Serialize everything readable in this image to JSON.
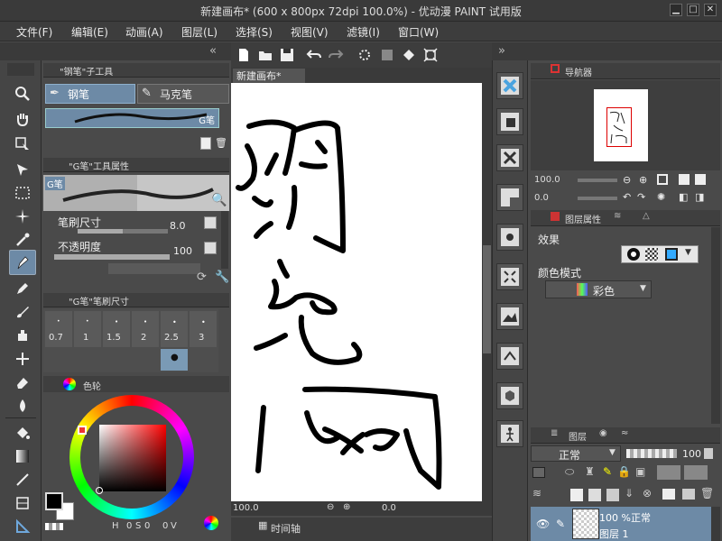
{
  "window": {
    "title": "新建画布* (600 x 800px 72dpi 100.0%) - 优动漫 PAINT 试用版"
  },
  "menu": [
    "文件(F)",
    "编辑(E)",
    "动画(A)",
    "图层(L)",
    "选择(S)",
    "视图(V)",
    "滤镜(I)",
    "窗口(W)"
  ],
  "subtool": {
    "header": "\"钢笔\"子工具",
    "tabs": [
      "钢笔",
      "马克笔"
    ],
    "selected_brush": "G笔"
  },
  "tool_property": {
    "header": "\"G笔\"工具属性",
    "brush_name": "G笔",
    "size_label": "笔刷尺寸",
    "size_value": "8.0",
    "opacity_label": "不透明度",
    "opacity_value": "100"
  },
  "brush_size": {
    "header": "\"G笔\"笔刷尺寸",
    "sizes": [
      "0.7",
      "1",
      "1.5",
      "2",
      "2.5",
      "3"
    ]
  },
  "color": {
    "tab_label": "色轮",
    "h_label": "H",
    "h_value": "0",
    "s_label": "S",
    "s_value": "0",
    "v_label": "V",
    "v_value": "0",
    "main": "#000000",
    "sub": "#ffffff"
  },
  "canvas": {
    "tab": "新建画布*",
    "zoom": "100.0",
    "rotation": "0.0",
    "timeline_label": "时间轴"
  },
  "navigator": {
    "tab": "导航器",
    "zoom": "100.0",
    "angle": "0.0"
  },
  "layer_property": {
    "tab": "图层属性",
    "effect_label": "效果",
    "color_mode_label": "颜色模式",
    "color_mode_value": "彩色"
  },
  "layers": {
    "tab": "图层",
    "blend_mode": "正常",
    "opacity": "100",
    "layer_blend_text": "100 %正常",
    "layer_name": "图层 1"
  }
}
